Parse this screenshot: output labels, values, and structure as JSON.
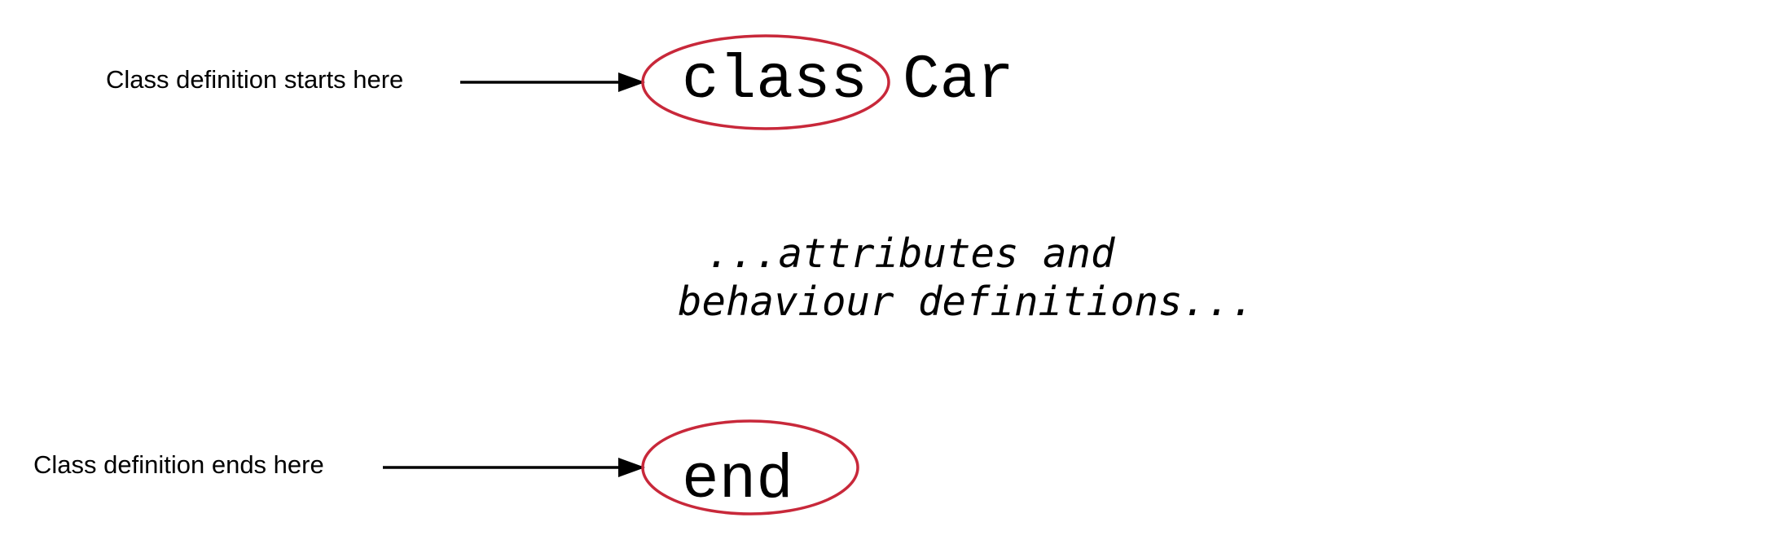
{
  "labels": {
    "start_annotation": "Class definition starts here",
    "end_annotation": "Class definition ends here"
  },
  "code": {
    "keyword_class": "class",
    "class_name": "Car",
    "body_line_1": "...attributes and",
    "body_line_2": "behaviour definitions...",
    "keyword_end": "end"
  },
  "colors": {
    "highlight_ellipse": "#c8283a",
    "arrow": "#000000",
    "text": "#000000",
    "background": "#ffffff"
  }
}
